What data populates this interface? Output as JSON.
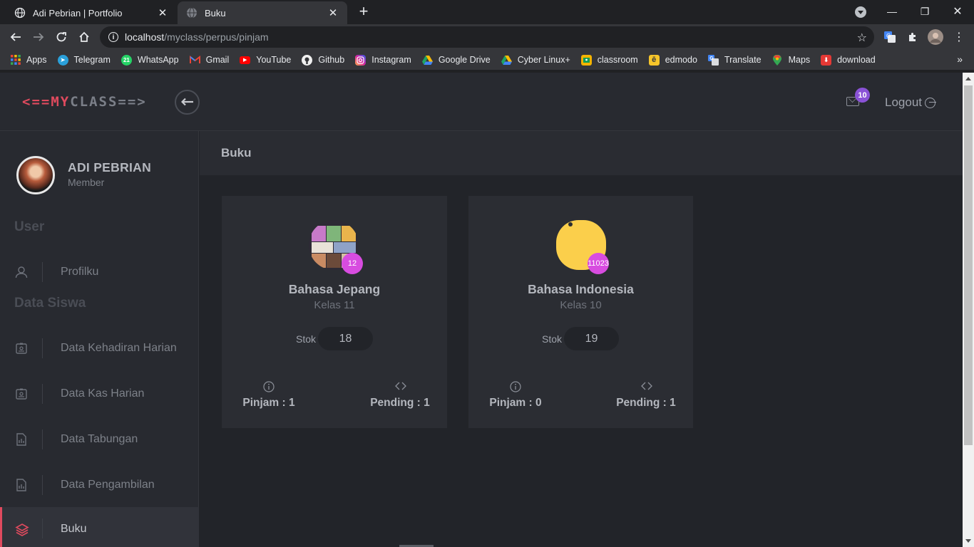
{
  "browser": {
    "tabs": [
      {
        "title": "Adi Pebrian | Portfolio",
        "active": false
      },
      {
        "title": "Buku",
        "active": true
      }
    ],
    "url_host": "localhost",
    "url_path": "/myclass/perpus/pinjam",
    "bookmarks": [
      {
        "label": "Apps",
        "icon": "apps-grid-icon",
        "color": "#ea4335"
      },
      {
        "label": "Telegram",
        "icon": "telegram-icon",
        "color": "#2aa0da"
      },
      {
        "label": "WhatsApp",
        "icon": "whatsapp-icon",
        "color": "#25d366"
      },
      {
        "label": "Gmail",
        "icon": "gmail-icon",
        "color": "#ea4335"
      },
      {
        "label": "YouTube",
        "icon": "youtube-icon",
        "color": "#ff0000"
      },
      {
        "label": "Github",
        "icon": "github-icon",
        "color": "#f0f0f0"
      },
      {
        "label": "Instagram",
        "icon": "instagram-icon",
        "color": "#d6249f"
      },
      {
        "label": "Google Drive",
        "icon": "google-drive-icon",
        "color": "#1fa463"
      },
      {
        "label": "Cyber Linux+",
        "icon": "google-drive-icon",
        "color": "#1fa463"
      },
      {
        "label": "classroom",
        "icon": "classroom-icon",
        "color": "#f4b400"
      },
      {
        "label": "edmodo",
        "icon": "edmodo-icon",
        "color": "#f6c52a"
      },
      {
        "label": "Translate",
        "icon": "translate-icon",
        "color": "#4285f4"
      },
      {
        "label": "Maps",
        "icon": "maps-icon",
        "color": "#34a853"
      },
      {
        "label": "download",
        "icon": "download-icon",
        "color": "#e53935"
      }
    ]
  },
  "app": {
    "brand_left": "<==MY",
    "brand_right": "CLASS==>",
    "mail_count": "10",
    "logout_label": "Logout",
    "user": {
      "name": "ADI PEBRIAN",
      "role": "Member"
    },
    "sections": {
      "user": "User",
      "data_siswa": "Data Siswa"
    },
    "nav": [
      {
        "label": "Profilku",
        "icon": "user-icon"
      },
      {
        "label": "Data Kehadiran Harian",
        "icon": "id-card-icon"
      },
      {
        "label": "Data Kas Harian",
        "icon": "id-card-icon"
      },
      {
        "label": "Data Tabungan",
        "icon": "document-chart-icon"
      },
      {
        "label": "Data Pengambilan",
        "icon": "document-chart-icon"
      },
      {
        "label": "Buku",
        "icon": "layers-icon"
      }
    ],
    "page_title": "Buku",
    "stok_label": "Stok",
    "books": [
      {
        "name": "Bahasa Jepang",
        "kelas": "Kelas 11",
        "count": "12",
        "stok": "18",
        "pinjam": "Pinjam : 1",
        "pending": "Pending : 1"
      },
      {
        "name": "Bahasa Indonesia",
        "kelas": "Kelas 10",
        "count": "11023",
        "stok": "19",
        "pinjam": "Pinjam : 0",
        "pending": "Pending : 1"
      }
    ]
  }
}
